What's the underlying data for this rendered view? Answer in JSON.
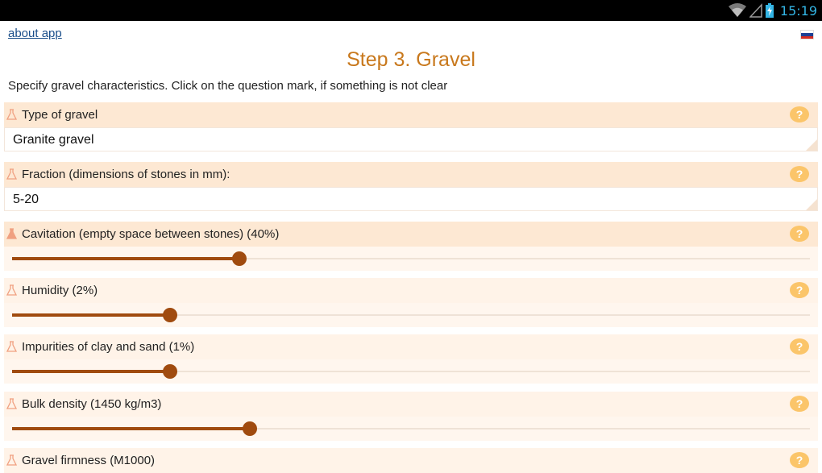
{
  "status_bar": {
    "time": "15:19"
  },
  "header": {
    "about_link": "about app",
    "flag_colors": [
      "#ffffff",
      "#1c3f94",
      "#d52b1e"
    ]
  },
  "page": {
    "title": "Step 3. Gravel",
    "subtitle": "Specify gravel characteristics. Click on the question mark, if something is not clear"
  },
  "help_symbol": "?",
  "fields": {
    "type": {
      "label": "Type of gravel",
      "value": "Granite gravel"
    },
    "fraction": {
      "label": "Fraction (dimensions of stones in mm):",
      "value": "5-20"
    }
  },
  "sliders": {
    "cavitation": {
      "label": "Cavitation (empty space between stones) (40%)",
      "value_fraction": 0.285
    },
    "humidity": {
      "label": "Humidity (2%)",
      "value_fraction": 0.198
    },
    "impurities": {
      "label": "Impurities of clay and sand (1%)",
      "value_fraction": 0.198
    },
    "bulk_density": {
      "label": "Bulk density (1450 kg/m3)",
      "value_fraction": 0.298
    },
    "firmness": {
      "label": "Gravel firmness (M1000)"
    }
  },
  "colors": {
    "accent": "#c8781c",
    "slider": "#a04b0f",
    "help": "#fbc56a",
    "section_bg": "#fde8d3"
  }
}
